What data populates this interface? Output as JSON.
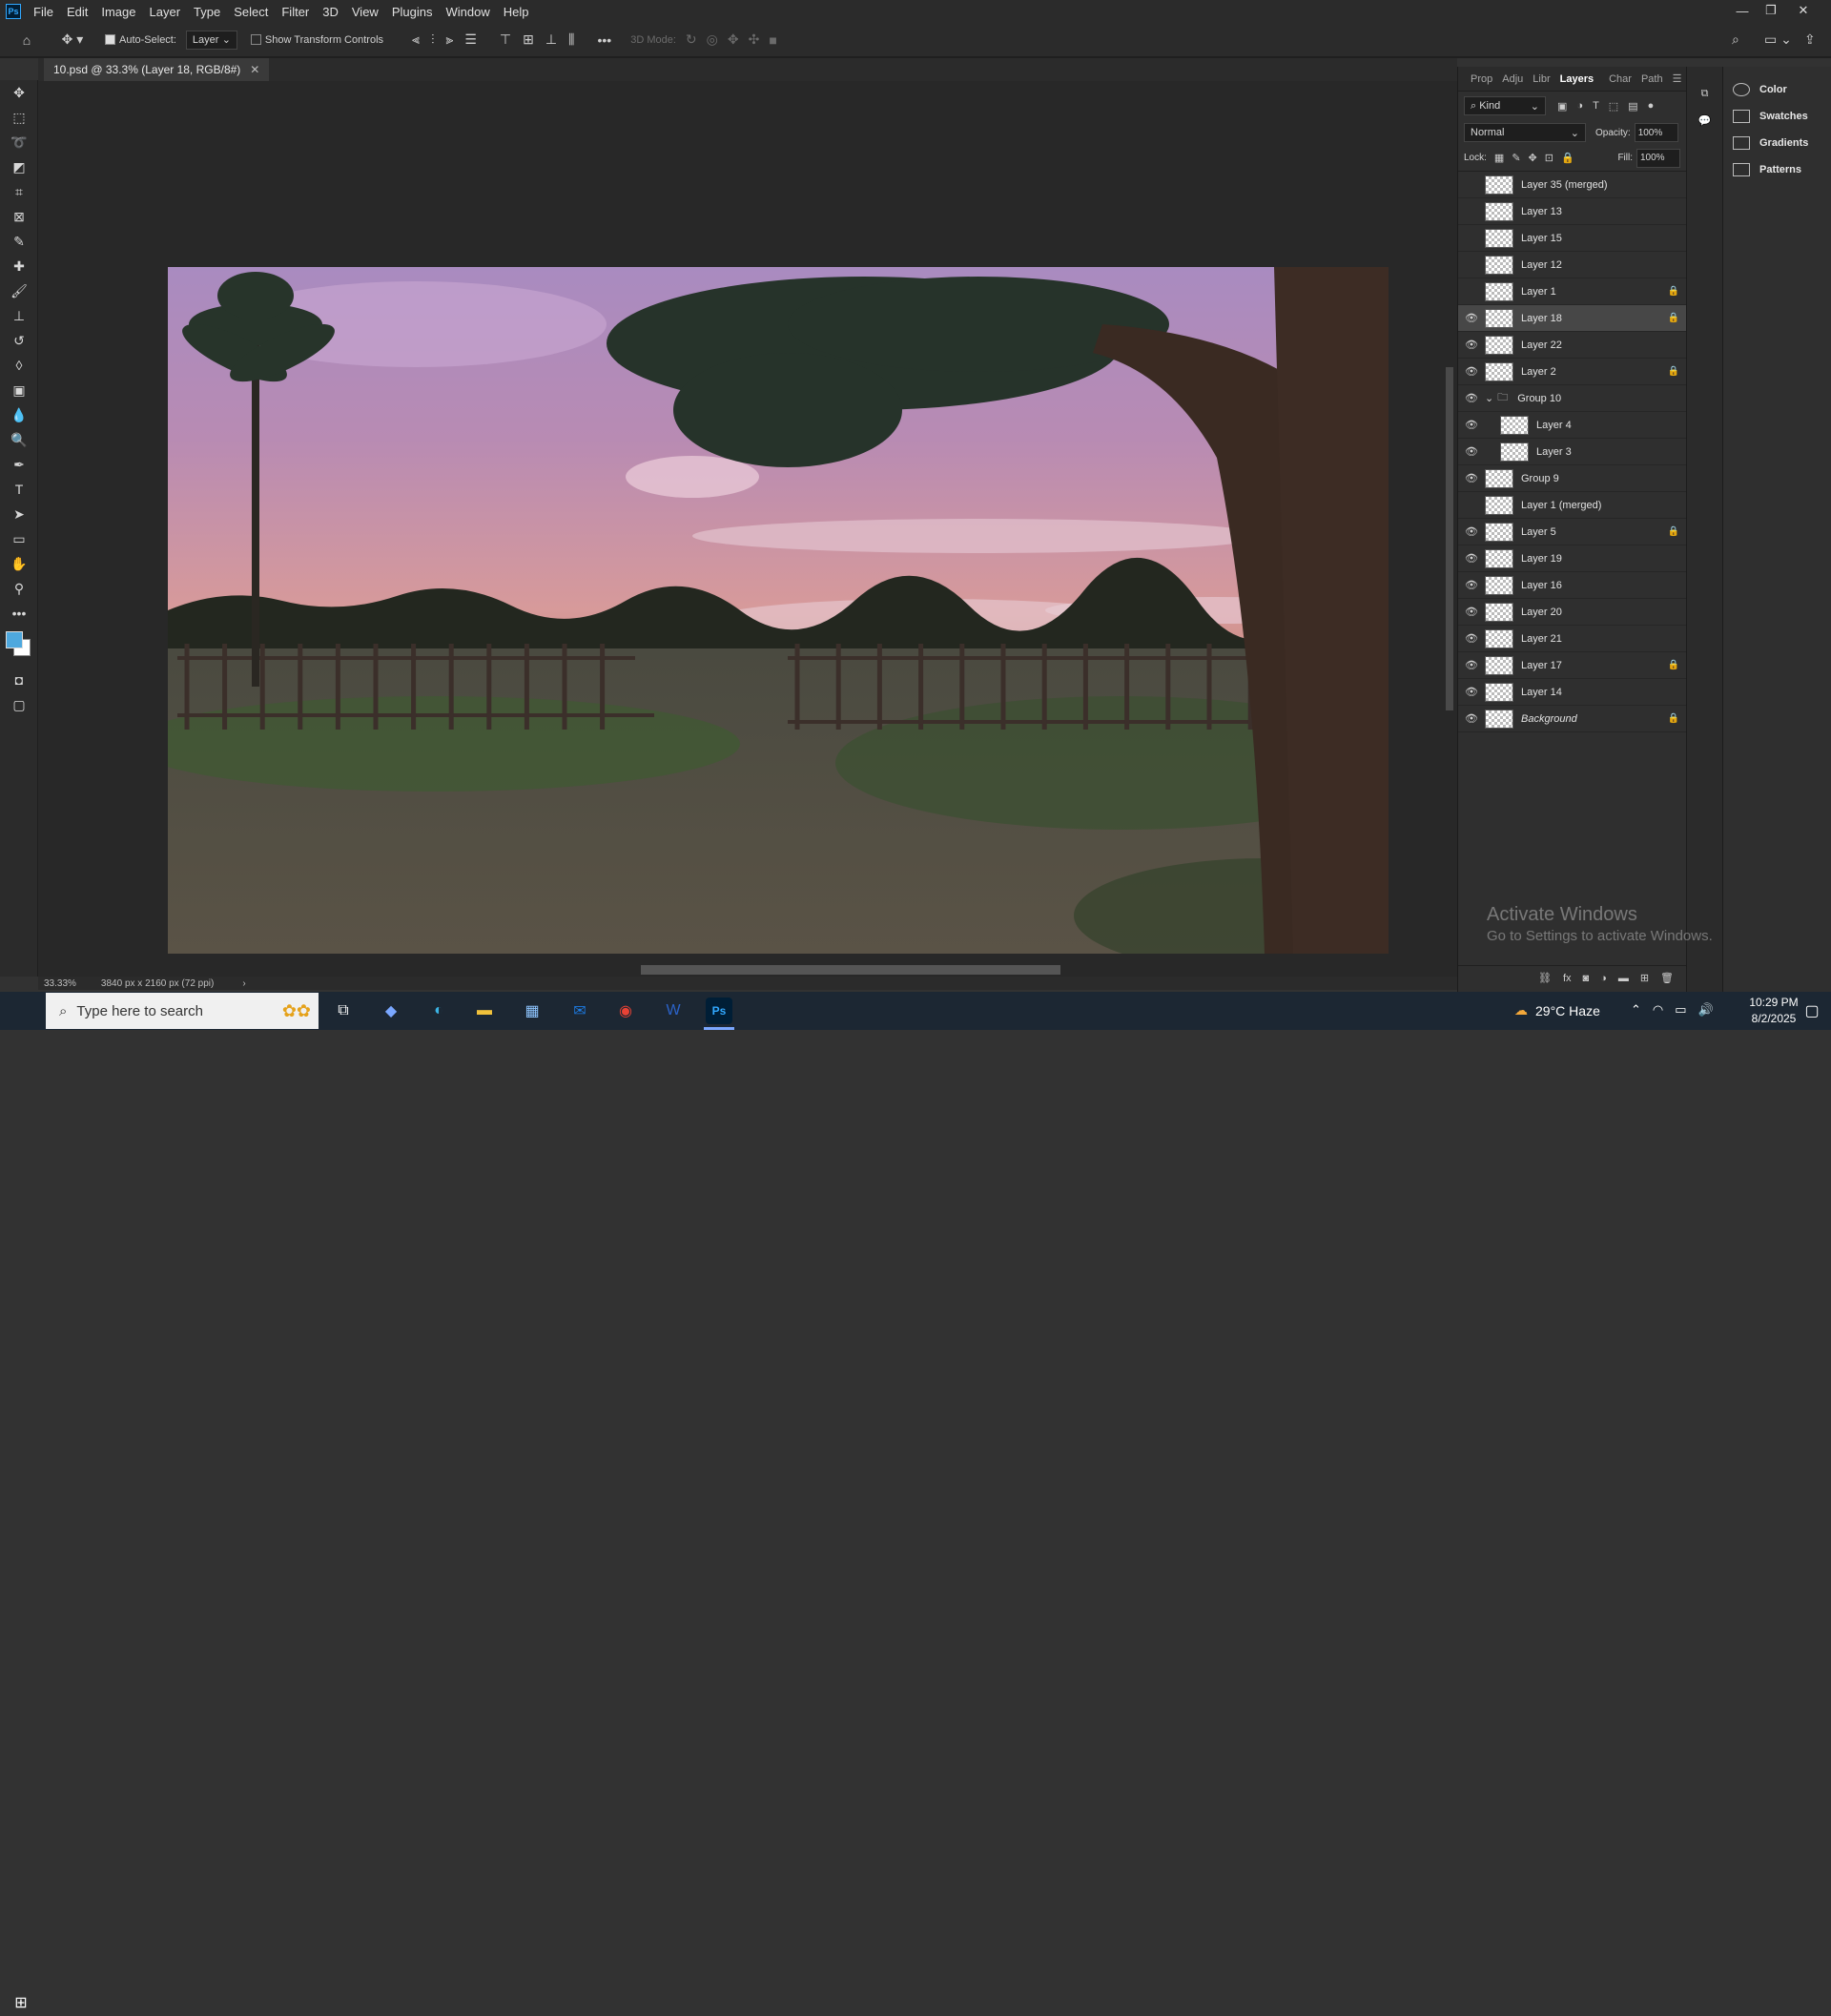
{
  "menubar": {
    "logo": "Ps",
    "items": [
      "File",
      "Edit",
      "Image",
      "Layer",
      "Type",
      "Select",
      "Filter",
      "3D",
      "View",
      "Plugins",
      "Window",
      "Help"
    ]
  },
  "options": {
    "auto_select_label": "Auto-Select:",
    "auto_select_value": "Layer",
    "show_transform_label": "Show Transform Controls",
    "mode_3d_label": "3D Mode:"
  },
  "document": {
    "tab_title": "10.psd @ 33.3% (Layer 18, RGB/8#)",
    "zoom": "33.33%",
    "dimensions": "3840 px x 2160 px (72 ppi)"
  },
  "layers_panel": {
    "tabs": [
      "Prop",
      "Adju",
      "Libr",
      "Layers",
      "Char",
      "Path"
    ],
    "active_tab": "Layers",
    "filter_kind": "Kind",
    "blend_mode": "Normal",
    "opacity_label": "Opacity:",
    "opacity_value": "100%",
    "lock_label": "Lock:",
    "fill_label": "Fill:",
    "fill_value": "100%",
    "layers": [
      {
        "name": "Layer 35 (merged)",
        "visible": false,
        "locked": false,
        "indent": 0
      },
      {
        "name": "Layer 13",
        "visible": false,
        "locked": false,
        "indent": 0
      },
      {
        "name": "Layer 15",
        "visible": false,
        "locked": false,
        "indent": 0
      },
      {
        "name": "Layer 12",
        "visible": false,
        "locked": false,
        "indent": 0
      },
      {
        "name": "Layer 1",
        "visible": false,
        "locked": true,
        "indent": 0
      },
      {
        "name": "Layer 18",
        "visible": true,
        "locked": true,
        "indent": 0,
        "selected": true
      },
      {
        "name": "Layer 22",
        "visible": true,
        "locked": false,
        "indent": 0
      },
      {
        "name": "Layer 2",
        "visible": true,
        "locked": true,
        "indent": 0
      },
      {
        "name": "Group 10",
        "visible": true,
        "locked": false,
        "indent": 0,
        "group": true
      },
      {
        "name": "Layer 4",
        "visible": true,
        "locked": false,
        "indent": 1
      },
      {
        "name": "Layer 3",
        "visible": true,
        "locked": false,
        "indent": 1
      },
      {
        "name": "Group 9",
        "visible": true,
        "locked": false,
        "indent": 0
      },
      {
        "name": "Layer 1 (merged)",
        "visible": false,
        "locked": false,
        "indent": 0
      },
      {
        "name": "Layer 5",
        "visible": true,
        "locked": true,
        "indent": 0
      },
      {
        "name": "Layer 19",
        "visible": true,
        "locked": false,
        "indent": 0
      },
      {
        "name": "Layer 16",
        "visible": true,
        "locked": false,
        "indent": 0
      },
      {
        "name": "Layer 20",
        "visible": true,
        "locked": false,
        "indent": 0
      },
      {
        "name": "Layer 21",
        "visible": true,
        "locked": false,
        "indent": 0
      },
      {
        "name": "Layer 17",
        "visible": true,
        "locked": true,
        "indent": 0
      },
      {
        "name": "Layer 14",
        "visible": true,
        "locked": false,
        "indent": 0
      },
      {
        "name": "Background",
        "visible": true,
        "locked": true,
        "indent": 0,
        "italic": true
      }
    ]
  },
  "side_panel": {
    "items": [
      "Color",
      "Swatches",
      "Gradients",
      "Patterns"
    ]
  },
  "watermark": {
    "line1": "Activate Windows",
    "line2": "Go to Settings to activate Windows."
  },
  "taskbar": {
    "search_placeholder": "Type here to search",
    "weather": "29°C  Haze",
    "time": "10:29 PM",
    "date": "8/2/2025"
  },
  "colors": {
    "foreground": "#4ea8de",
    "background": "#ffffff",
    "accent": "#31a8ff"
  }
}
